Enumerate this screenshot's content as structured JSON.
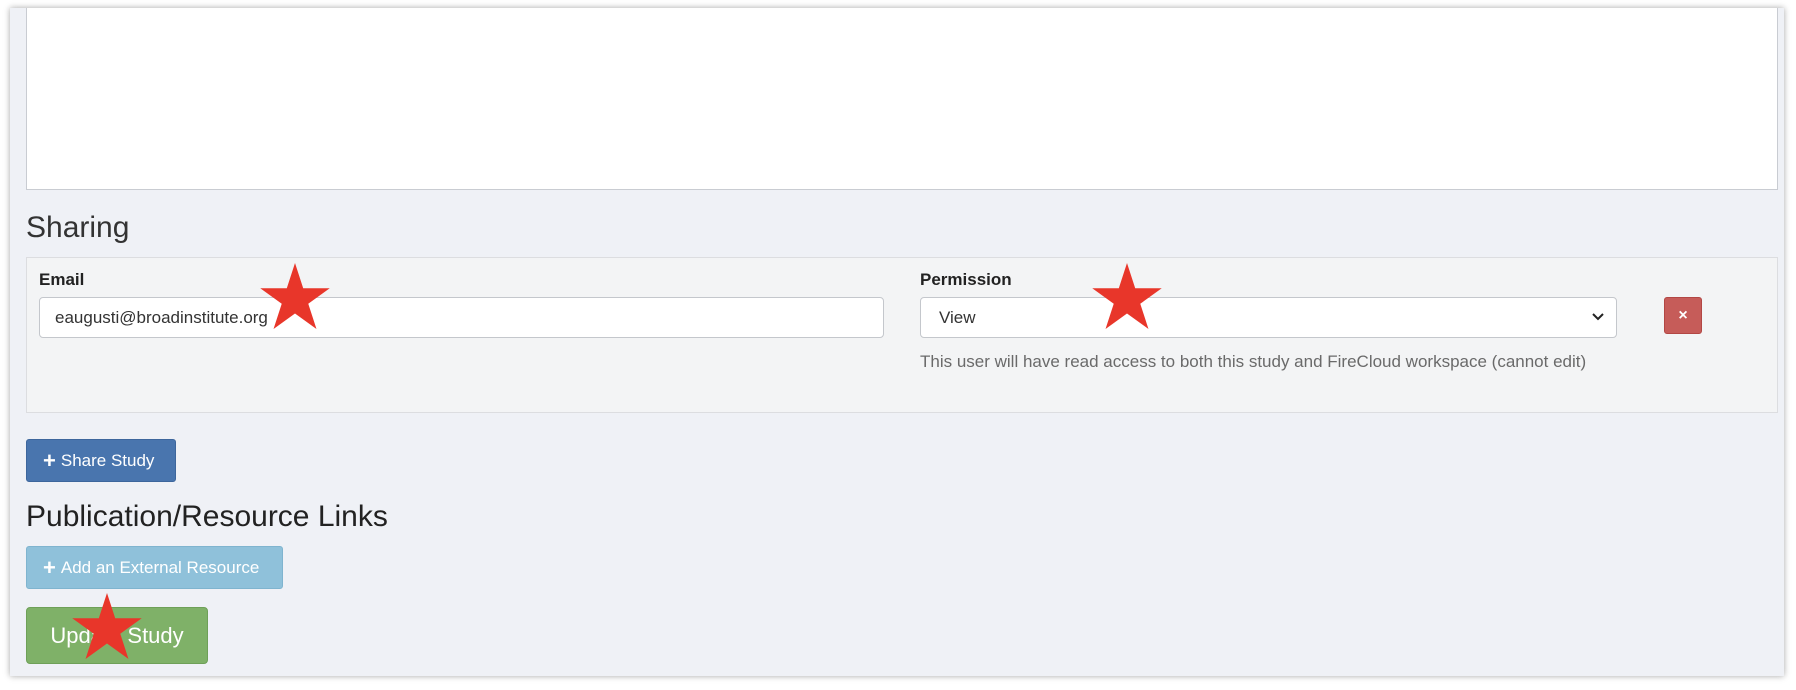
{
  "sharing": {
    "heading": "Sharing",
    "email_label": "Email",
    "email_value": "eaugusti@broadinstitute.org",
    "permission_label": "Permission",
    "permission_value": "View",
    "permission_help": "This user will have read access to both this study and FireCloud workspace (cannot edit)",
    "remove_symbol": "×",
    "share_button_label": "Share Study"
  },
  "publication": {
    "heading": "Publication/Resource Links",
    "add_button_label": "Add an External Resource"
  },
  "update_button_label": "Update Study",
  "colors": {
    "share_button": "#4975ae",
    "external_resource_button": "#8fc1da",
    "update_button": "#7fb168",
    "remove_button": "#c65c59",
    "annotation_star": "#e8362a"
  },
  "icons": {
    "plus": "plus-icon",
    "remove": "close-icon",
    "dropdown": "chevron-down-icon",
    "annotation": "star-icon"
  }
}
